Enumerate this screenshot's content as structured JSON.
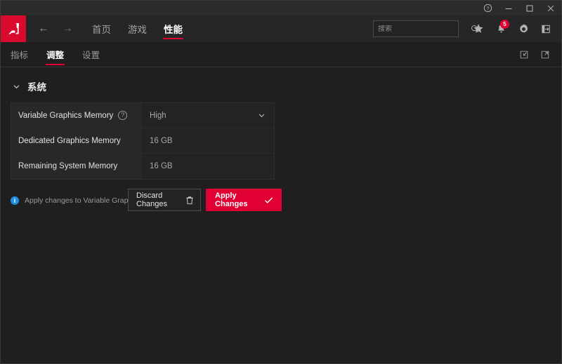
{
  "window": {
    "controls": {
      "help": "help-circle-icon",
      "minimize": "minimize-icon",
      "maximize": "maximize-icon",
      "close": "close-icon"
    }
  },
  "header": {
    "logo_alt": "AMD",
    "back_arrow": "←",
    "forward_arrow": "→",
    "tabs": [
      {
        "label": "首页",
        "active": false
      },
      {
        "label": "游戏",
        "active": false
      },
      {
        "label": "性能",
        "active": true
      }
    ],
    "search": {
      "placeholder": "搜索",
      "value": ""
    },
    "icons": {
      "favorites": "star-icon",
      "notifications": "bell-icon",
      "notifications_badge": "5",
      "settings": "gear-icon",
      "signout": "exit-icon"
    }
  },
  "subnav": {
    "tabs": [
      {
        "label": "指标",
        "active": false
      },
      {
        "label": "调整",
        "active": true
      },
      {
        "label": "设置",
        "active": false
      }
    ],
    "import_icon": "import-profile-icon",
    "export_icon": "export-profile-icon"
  },
  "section": {
    "title": "系统",
    "expanded": true,
    "rows": [
      {
        "label": "Variable Graphics Memory",
        "has_help": true,
        "value": "High",
        "control": "dropdown"
      },
      {
        "label": "Dedicated Graphics Memory",
        "has_help": false,
        "value": "16 GB",
        "control": "text"
      },
      {
        "label": "Remaining System Memory",
        "has_help": false,
        "value": "16 GB",
        "control": "text"
      }
    ]
  },
  "actions": {
    "note": "Apply changes to Variable Graphics Memory",
    "discard_label": "Discard Changes",
    "apply_label": "Apply Changes"
  },
  "colors": {
    "accent_red": "#e00034",
    "logo_red": "#da0a2e",
    "info_blue": "#1e8fe0",
    "background": "#1f1f1f",
    "panel": "#232323"
  }
}
